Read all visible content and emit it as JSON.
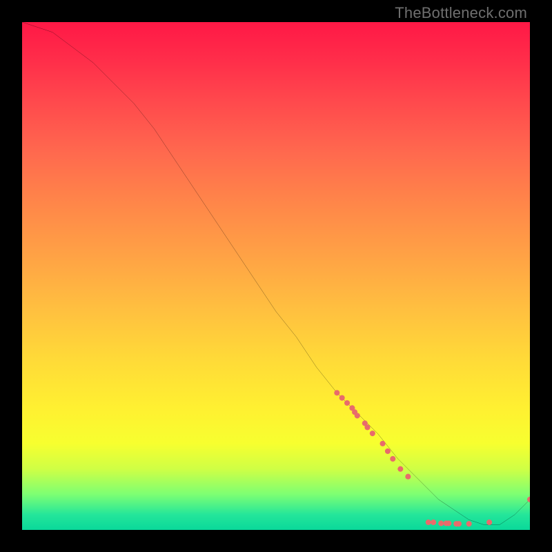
{
  "watermark": "TheBottleneck.com",
  "chart_data": {
    "type": "line",
    "title": "",
    "xlabel": "",
    "ylabel": "",
    "xlim": [
      0,
      100
    ],
    "ylim": [
      0,
      100
    ],
    "grid": false,
    "legend": false,
    "series": [
      {
        "name": "curve",
        "x": [
          0,
          3,
          6,
          10,
          14,
          18,
          22,
          26,
          30,
          34,
          38,
          42,
          46,
          50,
          54,
          58,
          62,
          66,
          70,
          74,
          78,
          82,
          85,
          88,
          91,
          94,
          97,
          100
        ],
        "y": [
          100,
          99,
          98,
          95,
          92,
          88,
          84,
          79,
          73,
          67,
          61,
          55,
          49,
          43,
          38,
          32,
          27,
          23,
          19,
          14,
          10,
          6,
          4,
          2,
          1,
          1,
          3,
          6
        ]
      }
    ],
    "markers": [
      {
        "x": 62,
        "y": 27
      },
      {
        "x": 63,
        "y": 26
      },
      {
        "x": 64,
        "y": 25
      },
      {
        "x": 65,
        "y": 24
      },
      {
        "x": 65.5,
        "y": 23.2
      },
      {
        "x": 66,
        "y": 22.5
      },
      {
        "x": 67.5,
        "y": 21
      },
      {
        "x": 68,
        "y": 20.2
      },
      {
        "x": 69,
        "y": 19
      },
      {
        "x": 71,
        "y": 17
      },
      {
        "x": 72,
        "y": 15.5
      },
      {
        "x": 73,
        "y": 14
      },
      {
        "x": 74.5,
        "y": 12
      },
      {
        "x": 76,
        "y": 10.5
      },
      {
        "x": 80,
        "y": 1.5
      },
      {
        "x": 81,
        "y": 1.5
      },
      {
        "x": 82.5,
        "y": 1.3
      },
      {
        "x": 83.5,
        "y": 1.3
      },
      {
        "x": 84,
        "y": 1.3
      },
      {
        "x": 85.5,
        "y": 1.2
      },
      {
        "x": 86,
        "y": 1.2
      },
      {
        "x": 88,
        "y": 1.2
      },
      {
        "x": 92,
        "y": 1.5
      },
      {
        "x": 100,
        "y": 6
      }
    ],
    "marker_color": "#e86b6b",
    "line_color": "#000000"
  }
}
